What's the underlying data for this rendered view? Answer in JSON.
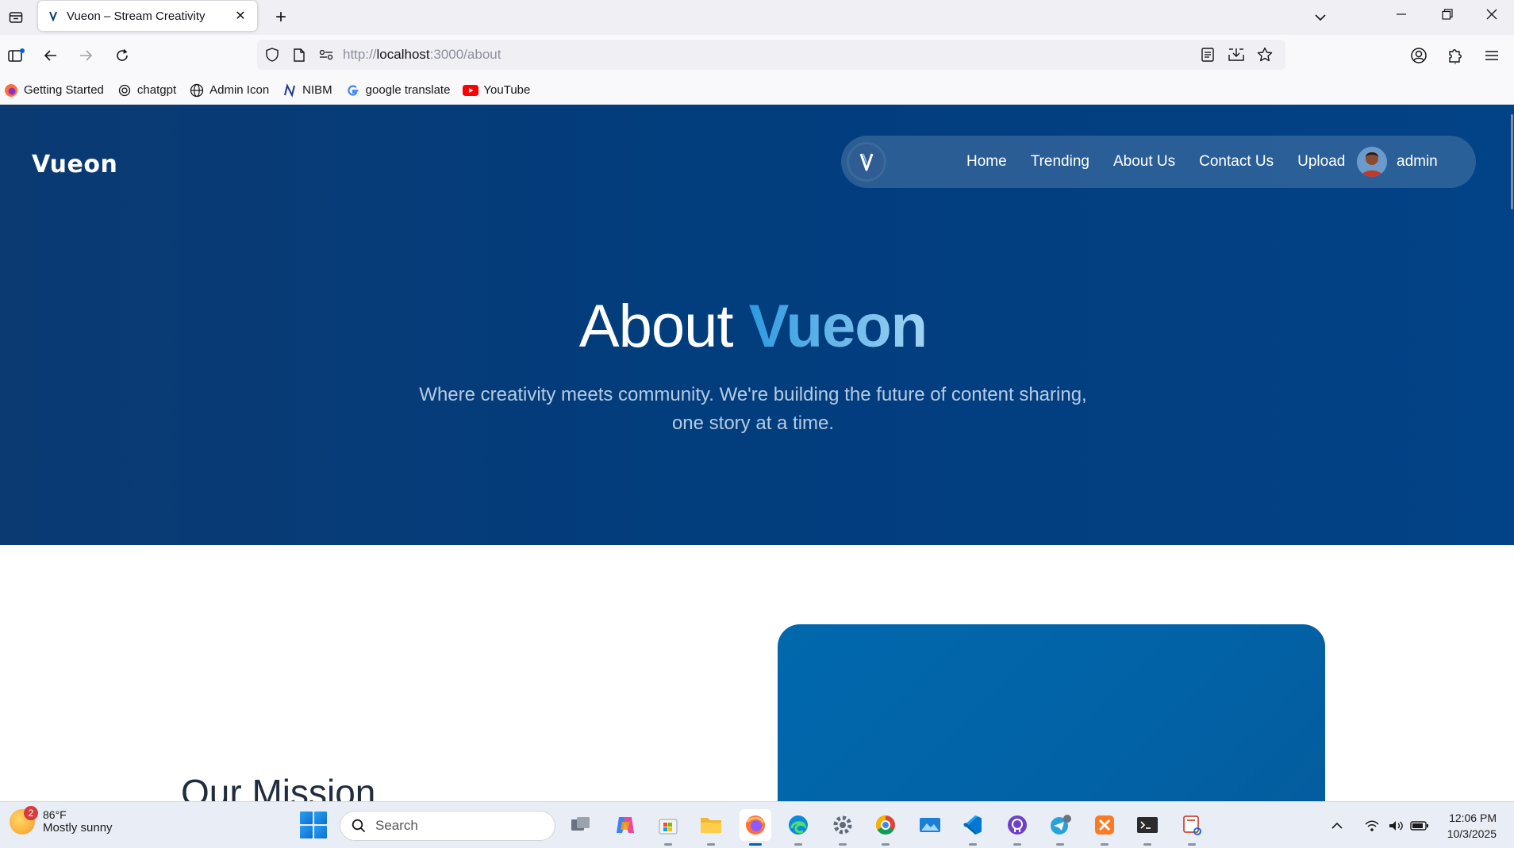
{
  "browser": {
    "tab_title": "Vueon – Stream Creativity",
    "url_prefix": "http://",
    "url_host": "localhost",
    "url_path": ":3000/about",
    "bookmarks": [
      {
        "label": "Getting Started",
        "icon": "firefox-icon"
      },
      {
        "label": "chatgpt",
        "icon": "chatgpt-icon"
      },
      {
        "label": "Admin Icon",
        "icon": "globe-icon"
      },
      {
        "label": "NIBM",
        "icon": "nibm-icon"
      },
      {
        "label": "google translate",
        "icon": "google-icon"
      },
      {
        "label": "YouTube",
        "icon": "youtube-icon"
      }
    ]
  },
  "site": {
    "logo": "Vueon",
    "nav": [
      {
        "label": "Home"
      },
      {
        "label": "Trending"
      },
      {
        "label": "About Us"
      },
      {
        "label": "Contact Us"
      },
      {
        "label": "Upload"
      }
    ],
    "user_name": "admin"
  },
  "hero": {
    "title_plain": "About ",
    "title_accent": "Vueon",
    "subtitle_line1": "Where creativity meets community. We're building the future of content sharing,",
    "subtitle_line2": "one story at a time."
  },
  "mission": {
    "title": "Our Mission"
  },
  "taskbar": {
    "weather_temp": "86°F",
    "weather_desc": "Mostly sunny",
    "weather_badge": "2",
    "search_placeholder": "Search",
    "time": "12:06 PM",
    "date": "10/3/2025",
    "apps": [
      "task-view",
      "copilot",
      "microsoft-store",
      "file-explorer",
      "firefox",
      "edge",
      "settings",
      "chrome",
      "photos",
      "vs-code",
      "github-desktop",
      "telegram",
      "xampp",
      "terminal",
      "snipping-tool"
    ]
  },
  "colors": {
    "hero_bg": "#023d7d",
    "accent": "#2f9ae0",
    "card_bg": "#0168ad"
  }
}
